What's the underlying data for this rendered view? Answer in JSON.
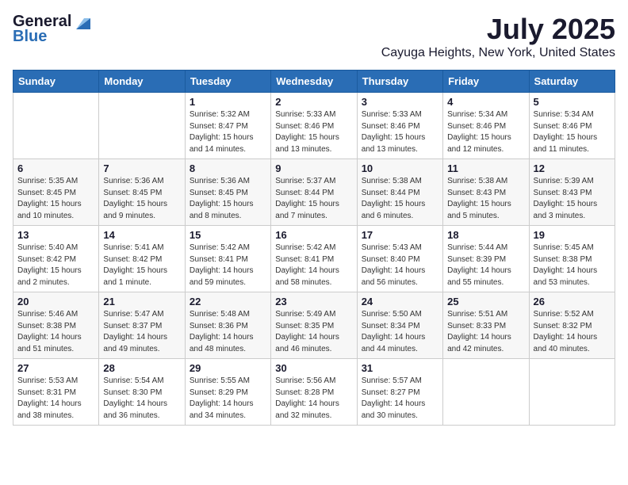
{
  "header": {
    "logo_general": "General",
    "logo_blue": "Blue",
    "month_title": "July 2025",
    "location": "Cayuga Heights, New York, United States"
  },
  "weekdays": [
    "Sunday",
    "Monday",
    "Tuesday",
    "Wednesday",
    "Thursday",
    "Friday",
    "Saturday"
  ],
  "weeks": [
    [
      {
        "day": "",
        "sunrise": "",
        "sunset": "",
        "daylight": ""
      },
      {
        "day": "",
        "sunrise": "",
        "sunset": "",
        "daylight": ""
      },
      {
        "day": "1",
        "sunrise": "Sunrise: 5:32 AM",
        "sunset": "Sunset: 8:47 PM",
        "daylight": "Daylight: 15 hours and 14 minutes."
      },
      {
        "day": "2",
        "sunrise": "Sunrise: 5:33 AM",
        "sunset": "Sunset: 8:46 PM",
        "daylight": "Daylight: 15 hours and 13 minutes."
      },
      {
        "day": "3",
        "sunrise": "Sunrise: 5:33 AM",
        "sunset": "Sunset: 8:46 PM",
        "daylight": "Daylight: 15 hours and 13 minutes."
      },
      {
        "day": "4",
        "sunrise": "Sunrise: 5:34 AM",
        "sunset": "Sunset: 8:46 PM",
        "daylight": "Daylight: 15 hours and 12 minutes."
      },
      {
        "day": "5",
        "sunrise": "Sunrise: 5:34 AM",
        "sunset": "Sunset: 8:46 PM",
        "daylight": "Daylight: 15 hours and 11 minutes."
      }
    ],
    [
      {
        "day": "6",
        "sunrise": "Sunrise: 5:35 AM",
        "sunset": "Sunset: 8:45 PM",
        "daylight": "Daylight: 15 hours and 10 minutes."
      },
      {
        "day": "7",
        "sunrise": "Sunrise: 5:36 AM",
        "sunset": "Sunset: 8:45 PM",
        "daylight": "Daylight: 15 hours and 9 minutes."
      },
      {
        "day": "8",
        "sunrise": "Sunrise: 5:36 AM",
        "sunset": "Sunset: 8:45 PM",
        "daylight": "Daylight: 15 hours and 8 minutes."
      },
      {
        "day": "9",
        "sunrise": "Sunrise: 5:37 AM",
        "sunset": "Sunset: 8:44 PM",
        "daylight": "Daylight: 15 hours and 7 minutes."
      },
      {
        "day": "10",
        "sunrise": "Sunrise: 5:38 AM",
        "sunset": "Sunset: 8:44 PM",
        "daylight": "Daylight: 15 hours and 6 minutes."
      },
      {
        "day": "11",
        "sunrise": "Sunrise: 5:38 AM",
        "sunset": "Sunset: 8:43 PM",
        "daylight": "Daylight: 15 hours and 5 minutes."
      },
      {
        "day": "12",
        "sunrise": "Sunrise: 5:39 AM",
        "sunset": "Sunset: 8:43 PM",
        "daylight": "Daylight: 15 hours and 3 minutes."
      }
    ],
    [
      {
        "day": "13",
        "sunrise": "Sunrise: 5:40 AM",
        "sunset": "Sunset: 8:42 PM",
        "daylight": "Daylight: 15 hours and 2 minutes."
      },
      {
        "day": "14",
        "sunrise": "Sunrise: 5:41 AM",
        "sunset": "Sunset: 8:42 PM",
        "daylight": "Daylight: 15 hours and 1 minute."
      },
      {
        "day": "15",
        "sunrise": "Sunrise: 5:42 AM",
        "sunset": "Sunset: 8:41 PM",
        "daylight": "Daylight: 14 hours and 59 minutes."
      },
      {
        "day": "16",
        "sunrise": "Sunrise: 5:42 AM",
        "sunset": "Sunset: 8:41 PM",
        "daylight": "Daylight: 14 hours and 58 minutes."
      },
      {
        "day": "17",
        "sunrise": "Sunrise: 5:43 AM",
        "sunset": "Sunset: 8:40 PM",
        "daylight": "Daylight: 14 hours and 56 minutes."
      },
      {
        "day": "18",
        "sunrise": "Sunrise: 5:44 AM",
        "sunset": "Sunset: 8:39 PM",
        "daylight": "Daylight: 14 hours and 55 minutes."
      },
      {
        "day": "19",
        "sunrise": "Sunrise: 5:45 AM",
        "sunset": "Sunset: 8:38 PM",
        "daylight": "Daylight: 14 hours and 53 minutes."
      }
    ],
    [
      {
        "day": "20",
        "sunrise": "Sunrise: 5:46 AM",
        "sunset": "Sunset: 8:38 PM",
        "daylight": "Daylight: 14 hours and 51 minutes."
      },
      {
        "day": "21",
        "sunrise": "Sunrise: 5:47 AM",
        "sunset": "Sunset: 8:37 PM",
        "daylight": "Daylight: 14 hours and 49 minutes."
      },
      {
        "day": "22",
        "sunrise": "Sunrise: 5:48 AM",
        "sunset": "Sunset: 8:36 PM",
        "daylight": "Daylight: 14 hours and 48 minutes."
      },
      {
        "day": "23",
        "sunrise": "Sunrise: 5:49 AM",
        "sunset": "Sunset: 8:35 PM",
        "daylight": "Daylight: 14 hours and 46 minutes."
      },
      {
        "day": "24",
        "sunrise": "Sunrise: 5:50 AM",
        "sunset": "Sunset: 8:34 PM",
        "daylight": "Daylight: 14 hours and 44 minutes."
      },
      {
        "day": "25",
        "sunrise": "Sunrise: 5:51 AM",
        "sunset": "Sunset: 8:33 PM",
        "daylight": "Daylight: 14 hours and 42 minutes."
      },
      {
        "day": "26",
        "sunrise": "Sunrise: 5:52 AM",
        "sunset": "Sunset: 8:32 PM",
        "daylight": "Daylight: 14 hours and 40 minutes."
      }
    ],
    [
      {
        "day": "27",
        "sunrise": "Sunrise: 5:53 AM",
        "sunset": "Sunset: 8:31 PM",
        "daylight": "Daylight: 14 hours and 38 minutes."
      },
      {
        "day": "28",
        "sunrise": "Sunrise: 5:54 AM",
        "sunset": "Sunset: 8:30 PM",
        "daylight": "Daylight: 14 hours and 36 minutes."
      },
      {
        "day": "29",
        "sunrise": "Sunrise: 5:55 AM",
        "sunset": "Sunset: 8:29 PM",
        "daylight": "Daylight: 14 hours and 34 minutes."
      },
      {
        "day": "30",
        "sunrise": "Sunrise: 5:56 AM",
        "sunset": "Sunset: 8:28 PM",
        "daylight": "Daylight: 14 hours and 32 minutes."
      },
      {
        "day": "31",
        "sunrise": "Sunrise: 5:57 AM",
        "sunset": "Sunset: 8:27 PM",
        "daylight": "Daylight: 14 hours and 30 minutes."
      },
      {
        "day": "",
        "sunrise": "",
        "sunset": "",
        "daylight": ""
      },
      {
        "day": "",
        "sunrise": "",
        "sunset": "",
        "daylight": ""
      }
    ]
  ]
}
